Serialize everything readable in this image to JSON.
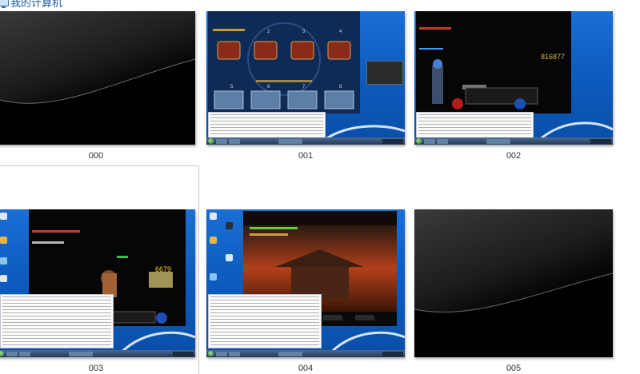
{
  "breadcrumb": {
    "title": "我的计算机"
  },
  "thumbnails": [
    {
      "caption": "000",
      "kind": "black"
    },
    {
      "caption": "001",
      "kind": "desktop-game-reward"
    },
    {
      "caption": "002",
      "kind": "desktop-game-battle"
    },
    {
      "caption": "003",
      "kind": "desktop-game-battle",
      "selected": true
    },
    {
      "caption": "004",
      "kind": "desktop-game-loading"
    },
    {
      "caption": "005",
      "kind": "black"
    }
  ],
  "colors": {
    "link_blue": "#1e5aa8",
    "desktop_blue": "#0d5cc0",
    "caption_text": "#333333"
  }
}
